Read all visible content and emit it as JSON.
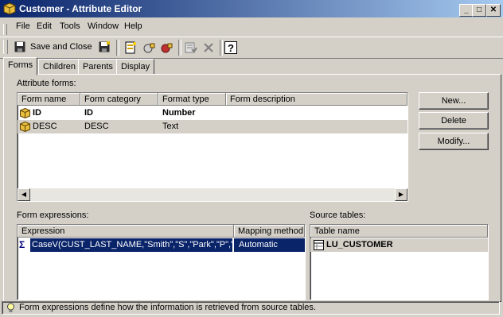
{
  "window": {
    "title": "Customer - Attribute Editor"
  },
  "menu": [
    {
      "label": "File"
    },
    {
      "label": "Edit"
    },
    {
      "label": "Tools"
    },
    {
      "label": "Window"
    },
    {
      "label": "Help"
    }
  ],
  "toolbar": {
    "save_close_label": "Save and Close"
  },
  "tabs": [
    {
      "label": "Forms",
      "active": true
    },
    {
      "label": "Children"
    },
    {
      "label": "Parents"
    },
    {
      "label": "Display"
    }
  ],
  "attribute_forms": {
    "label": "Attribute forms:",
    "columns": [
      "Form name",
      "Form category",
      "Format type",
      "Form description"
    ],
    "rows": [
      {
        "name": "ID",
        "category": "ID",
        "format": "Number",
        "description": "",
        "bold": true
      },
      {
        "name": "DESC",
        "category": "DESC",
        "format": "Text",
        "description": "",
        "bold": false
      }
    ]
  },
  "buttons": {
    "new": "New...",
    "delete": "Delete",
    "modify": "Modify..."
  },
  "form_expressions": {
    "label": "Form expressions:",
    "columns": [
      "Expression",
      "Mapping method"
    ],
    "rows": [
      {
        "expression": "CaseV(CUST_LAST_NAME,\"Smith\",\"S\",\"Park\",\"P\",\"\")",
        "mapping": "Automatic"
      }
    ]
  },
  "source_tables": {
    "label": "Source tables:",
    "columns": [
      "Table name"
    ],
    "rows": [
      {
        "name": "LU_CUSTOMER"
      }
    ]
  },
  "status": {
    "text": "Form expressions define how the information is retrieved from source tables."
  }
}
